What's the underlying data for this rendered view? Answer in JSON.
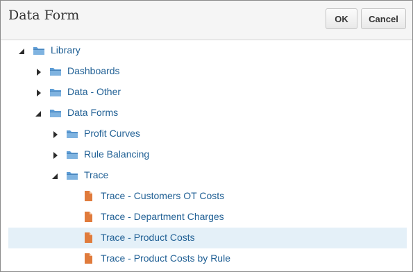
{
  "dialog": {
    "title": "Data Form",
    "ok_label": "OK",
    "cancel_label": "Cancel"
  },
  "tree": {
    "nodes": [
      {
        "label": "Library",
        "type": "folder",
        "state": "expanded",
        "level": 0,
        "selected": false
      },
      {
        "label": "Dashboards",
        "type": "folder",
        "state": "collapsed",
        "level": 1,
        "selected": false
      },
      {
        "label": "Data - Other",
        "type": "folder",
        "state": "collapsed",
        "level": 1,
        "selected": false
      },
      {
        "label": "Data Forms",
        "type": "folder",
        "state": "expanded",
        "level": 1,
        "selected": false
      },
      {
        "label": "Profit Curves",
        "type": "folder",
        "state": "collapsed",
        "level": 2,
        "selected": false
      },
      {
        "label": "Rule Balancing",
        "type": "folder",
        "state": "collapsed",
        "level": 2,
        "selected": false
      },
      {
        "label": "Trace",
        "type": "folder",
        "state": "expanded",
        "level": 2,
        "selected": false
      },
      {
        "label": "Trace - Customers OT Costs",
        "type": "document",
        "state": "leaf",
        "level": 3,
        "selected": false
      },
      {
        "label": "Trace - Department Charges",
        "type": "document",
        "state": "leaf",
        "level": 3,
        "selected": false
      },
      {
        "label": "Trace - Product Costs",
        "type": "document",
        "state": "leaf",
        "level": 3,
        "selected": true
      },
      {
        "label": "Trace - Product Costs by Rule",
        "type": "document",
        "state": "leaf",
        "level": 3,
        "selected": false
      }
    ]
  },
  "colors": {
    "link": "#1f5f94",
    "folder": "#5b9bd5",
    "document": "#e07b3c",
    "selected_row": "#e4f0f8"
  }
}
